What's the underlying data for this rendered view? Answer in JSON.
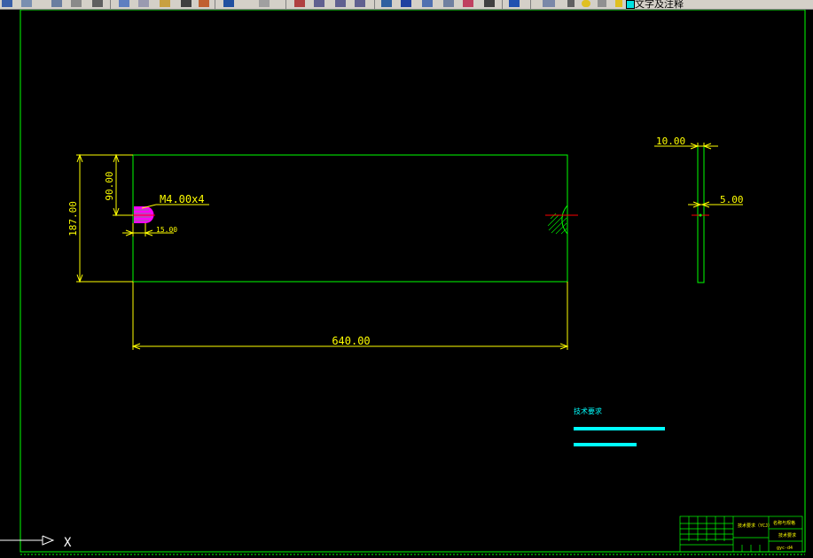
{
  "toolbar": {
    "layer_label": "文字及注释",
    "icons": [
      "save-icon",
      "print-icon",
      "preview-icon",
      "publish-icon",
      "cut-icon",
      "copy-icon",
      "paste-icon",
      "match-icon",
      "brush-icon",
      "undo-icon",
      "redo-icon",
      "pan-icon",
      "zoom-realtime-icon",
      "zoom-window-icon",
      "zoom-previous-icon",
      "text-style-icon",
      "properties-icon",
      "design-center-icon",
      "tool-palette-icon",
      "calc-icon",
      "table-icon",
      "help-icon",
      "layer-manager-icon",
      "layer-state-icon"
    ]
  },
  "drawing": {
    "dim_width": "640.00",
    "dim_height": "187.00",
    "dim_hole_offset": "90.00",
    "dim_hole_depth": "15.00",
    "thread_label": "M4.00x4",
    "dim_side_width": "10.00",
    "dim_side_hole": "5.00",
    "tech_requirements_label": "技术要求",
    "ucs_x_label": "X"
  },
  "title_block": {
    "cells": [
      "技术要求（YCJ）",
      "名称与规格",
      "技术要求",
      "gyc-d4"
    ]
  },
  "colors": {
    "background": "#000000",
    "border": "#00ff00",
    "dimension": "#ffff00",
    "text_cyan": "#00ffff",
    "hatch_red": "#ff0000",
    "hatch_magenta": "#ff00ff",
    "toolbar": "#d4d0c8"
  }
}
